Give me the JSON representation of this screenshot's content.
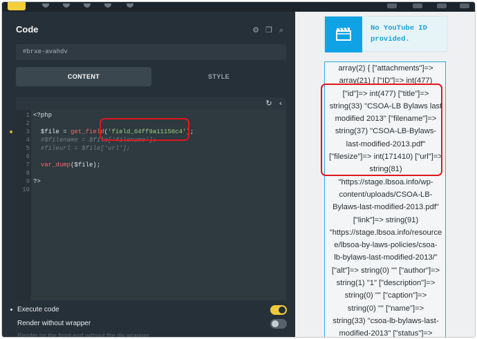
{
  "panel": {
    "title": "Code",
    "css_id": "#brxe-avahdv",
    "tabs": [
      {
        "label": "CONTENT",
        "active": true
      },
      {
        "label": "STYLE",
        "active": false
      }
    ],
    "editor_tools": {
      "refresh_icon": "refresh-icon",
      "collapse_icon": "chevron-left-icon"
    },
    "header_icons": [
      "toggle-view-icon",
      "copy-icon",
      "search-icon"
    ]
  },
  "editor": {
    "line_numbers": [
      "1",
      "2",
      "3",
      "4",
      "5",
      "6",
      "7",
      "8",
      "9",
      "10"
    ],
    "modified_line": 3,
    "lines": {
      "l1": "<?php",
      "l3_a": "$file = ",
      "l3_fn": "get_field",
      "l3_b": "(",
      "l3_str": "'field_64ff9a11156c4'",
      "l3_c": ");",
      "l4": "#$filename = $file['filename'];",
      "l5": "#fileurl = $file['url'];",
      "l7_fn": "var_dump",
      "l7_rest": "($file);",
      "l9": "?>"
    }
  },
  "settings": [
    {
      "label": "Execute code",
      "enabled": true
    },
    {
      "label": "Render without wrapper",
      "enabled": false
    }
  ],
  "faded_text": "Render on the front-end without the div wrapper",
  "preview": {
    "youtube_notice": {
      "line1": "No YouTube ID",
      "line2": "provided.",
      "icon": "film-clapper-icon"
    },
    "dump_lines": [
      "array(2) { [\"attachments\"]=>",
      "array(21) { [\"ID\"]=> int(477)",
      "[\"id\"]=> int(477) [\"title\"]=>",
      "string(33) \"CSOA-LB Bylaws last",
      "modified 2013\" [\"filename\"]=>",
      "string(37) \"CSOA-LB-Bylaws-",
      "last-modified-2013.pdf\"",
      "[\"filesize\"]=> int(171410) [\"url\"]=>",
      "string(81)",
      "\"https://stage.lbsoa.info/wp-",
      "content/uploads/CSOA-LB-",
      "Bylaws-last-modified-2013.pdf\"",
      "[\"link\"]=> string(91)",
      "\"https://stage.lbsoa.info/resource",
      "e/lbsoa-by-laws-policies/csoa-",
      "lb-bylaws-last-modified-2013/\"",
      "[\"alt\"]=> string(0) \"\" [\"author\"]=>",
      "string(1) \"1\" [\"description\"]=>",
      "string(0) \"\" [\"caption\"]=>",
      "string(0) \"\" [\"name\"]=>",
      "string(33) \"csoa-lb-bylaws-last-",
      "modified-2013\" [\"status\"]=>"
    ]
  },
  "colors": {
    "panel_bg": "#263038",
    "accent_yellow": "#f0c93a",
    "annotation_red": "#e3141c",
    "preview_blue": "#0fa3e6"
  }
}
